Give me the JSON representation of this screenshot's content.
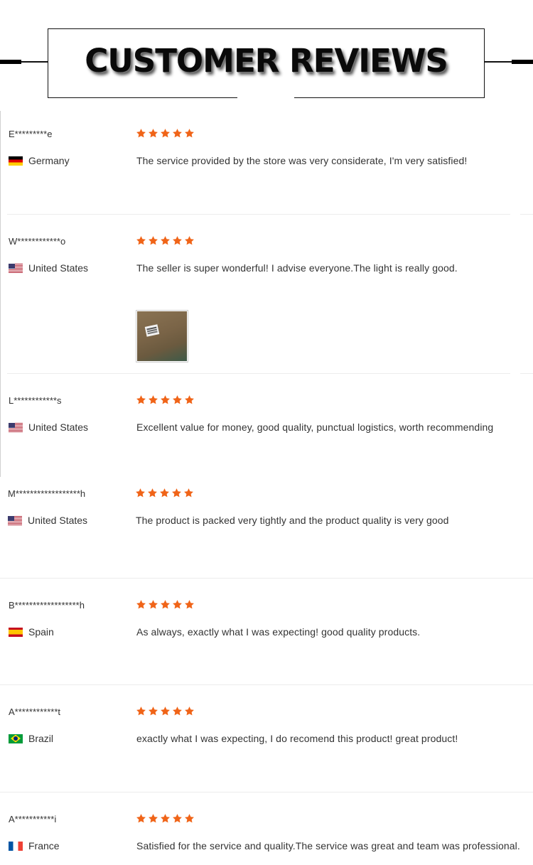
{
  "header": {
    "title": "CUSTOMER REVIEWS"
  },
  "colors": {
    "star": "#f06418",
    "divider": "#ececec"
  },
  "reviews": [
    {
      "name": "E*********e",
      "country": "Germany",
      "flag": "flag-germany",
      "rating": 5,
      "text": "The service provided by the store was very considerate, I'm very satisfied!"
    },
    {
      "name": "W************o",
      "country": "United States",
      "flag": "flag-united-states",
      "rating": 5,
      "text": "The seller is super wonderful! I advise everyone.The light is really good.",
      "has_photo": true
    },
    {
      "name": "L************s",
      "country": "United States",
      "flag": "flag-united-states",
      "rating": 5,
      "text": "Excellent value for money, good quality, punctual logistics, worth recommending"
    },
    {
      "name": "M******************h",
      "country": "United States",
      "flag": "flag-united-states",
      "rating": 5,
      "text": "The product is packed very tightly and the product quality is very good"
    },
    {
      "name": "B******************h",
      "country": "Spain",
      "flag": "flag-spain",
      "rating": 5,
      "text": "As always, exactly what I was expecting! good quality products."
    },
    {
      "name": "A************t",
      "country": "Brazil",
      "flag": "flag-brazil",
      "rating": 5,
      "text": "exactly what I was expecting, I do recomend this product! great product!"
    },
    {
      "name": "A***********i",
      "country": "France",
      "flag": "flag-france",
      "rating": 5,
      "text": "Satisfied for the service and quality.The service was great and team was professional."
    }
  ]
}
